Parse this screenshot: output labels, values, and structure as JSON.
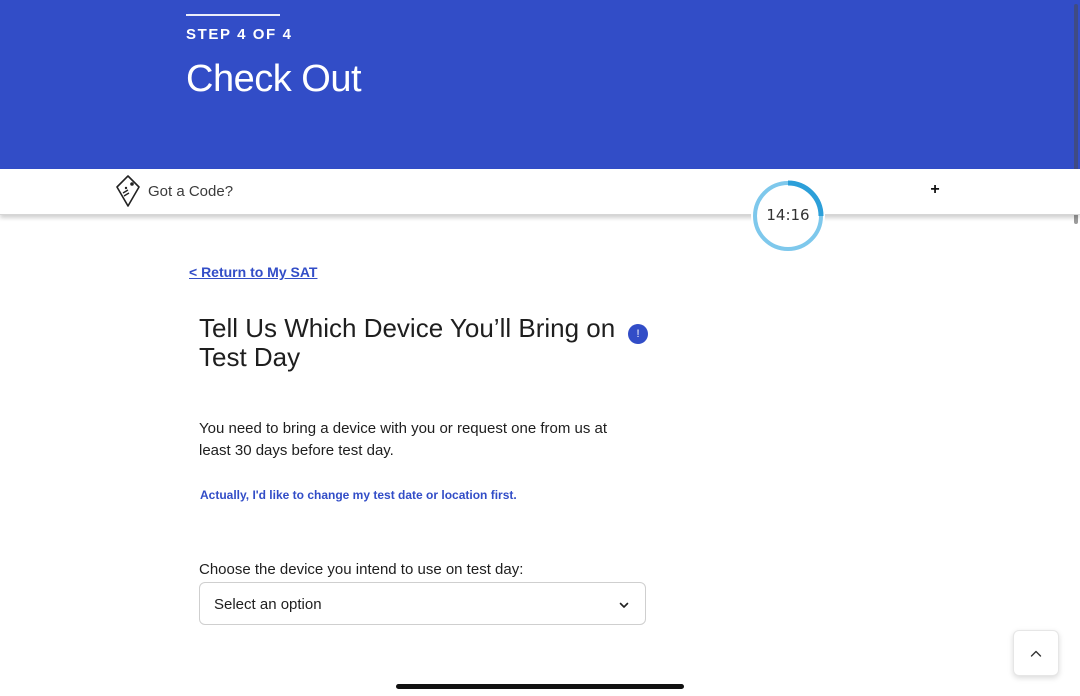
{
  "header": {
    "step_label": "STEP 4 OF 4",
    "title": "Check Out",
    "background_color": "#324dc7"
  },
  "code_bar": {
    "icon": "tag-icon",
    "label": "Got a Code?"
  },
  "timer": {
    "time": "14:16",
    "progress_fraction": 0.25,
    "ring_color": "#2c9fd9"
  },
  "toolbar": {
    "expand_icon": "plus-icon",
    "expand_label": "+"
  },
  "nav": {
    "back_label": "< Return to My SAT"
  },
  "section": {
    "title": "Tell Us Which Device You’ll Bring on Test Day",
    "info_icon": "info-icon",
    "info_label": "!",
    "description": "You need to bring a device with you or request one from us at least 30 days before test day.",
    "change_link": "Actually, I'd like to change my test date or location first."
  },
  "device_field": {
    "label": "Choose the device you intend to use on test day:",
    "selected_value": "Select an option",
    "chevron_icon": "chevron-down-icon"
  },
  "scroll_top": {
    "icon": "chevron-up-icon"
  },
  "colors": {
    "accent": "#324dc7",
    "text": "#1e1e1e"
  }
}
